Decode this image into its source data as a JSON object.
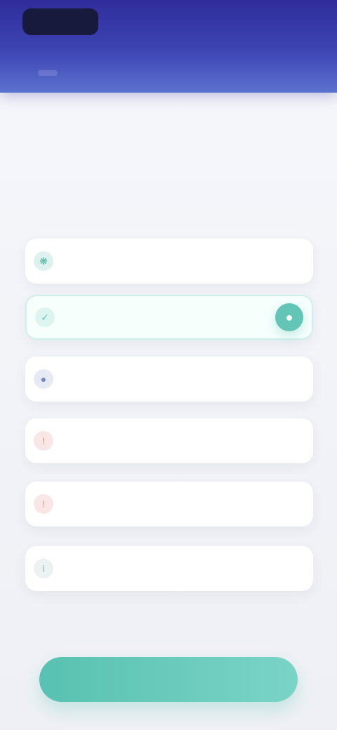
{
  "header": {
    "logo": "",
    "action": "",
    "tabs": [
      {
        "label": ""
      },
      {
        "label": ""
      }
    ]
  },
  "intro": {
    "title": "",
    "body": ""
  },
  "options": [
    {
      "label": "",
      "icon": "leaf-icon",
      "accent": "#4cb39f"
    },
    {
      "label": "",
      "icon": "check-icon",
      "accent": "#63c5b6",
      "selected": true
    },
    {
      "label": "",
      "icon": "user-icon",
      "accent": "#7a83c8"
    },
    {
      "label": "",
      "icon": "alert-icon",
      "accent": "#e58e93"
    },
    {
      "label": "",
      "icon": "alert-icon",
      "accent": "#e58e93"
    },
    {
      "label": "",
      "icon": "info-icon",
      "accent": "#8fb7b2"
    }
  ],
  "cta": {
    "label": ""
  },
  "colors": {
    "header_start": "#2f2d9b",
    "header_end": "#5c72cf",
    "primary": "#63c5b6",
    "background": "#f1f2f6"
  }
}
